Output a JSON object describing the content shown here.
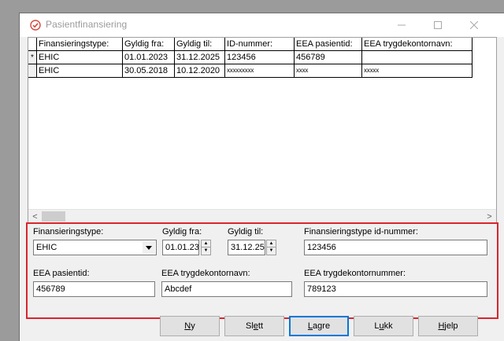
{
  "window": {
    "title": "Pasientfinansiering",
    "minimize_glyph": "—",
    "maximize_glyph": "☐",
    "close_glyph": "✕"
  },
  "grid": {
    "columns": [
      "Finansieringstype:",
      "Gyldig fra:",
      "Gyldig til:",
      "ID-nummer:",
      "EEA pasientid:",
      "EEA trygdekontornavn:"
    ],
    "rows": [
      {
        "marker": "*",
        "cells": [
          "EHIC",
          "01.01.2023",
          "31.12.2025",
          "123456",
          "456789",
          ""
        ]
      },
      {
        "marker": "",
        "cells": [
          "EHIC",
          "30.05.2018",
          "10.12.2020",
          "xxxxxxxxx",
          "xxxx",
          "xxxxx"
        ]
      }
    ],
    "scroll_left": "<",
    "scroll_right": ">"
  },
  "form": {
    "finansieringstype_label": "Finansieringstype:",
    "finansieringstype_value": "EHIC",
    "gyldig_fra_label": "Gyldig fra:",
    "gyldig_fra_value": "01.01.23",
    "gyldig_til_label": "Gyldig til:",
    "gyldig_til_value": "31.12.25",
    "id_nummer_label": "Finansieringstype id-nummer:",
    "id_nummer_value": "123456",
    "eea_pasientid_label": "EEA pasientid:",
    "eea_pasientid_value": "456789",
    "eea_trygdekontornavn_label": "EEA trygdekontornavn:",
    "eea_trygdekontornavn_value": "Abcdef",
    "eea_trygdekontornummer_label": "EEA trygdekontornummer:",
    "eea_trygdekontornummer_value": "789123"
  },
  "buttons": {
    "ny": {
      "access": "N",
      "rest": "y"
    },
    "slett": {
      "pre": "Sl",
      "access": "e",
      "rest": "tt"
    },
    "lagre": {
      "access": "L",
      "rest": "agre"
    },
    "lukk": {
      "pre": "L",
      "access": "u",
      "rest": "kk"
    },
    "hjelp": {
      "access": "H",
      "rest": "jelp"
    }
  },
  "colors": {
    "highlight": "#d9252c",
    "default_button_border": "#0078d7"
  }
}
